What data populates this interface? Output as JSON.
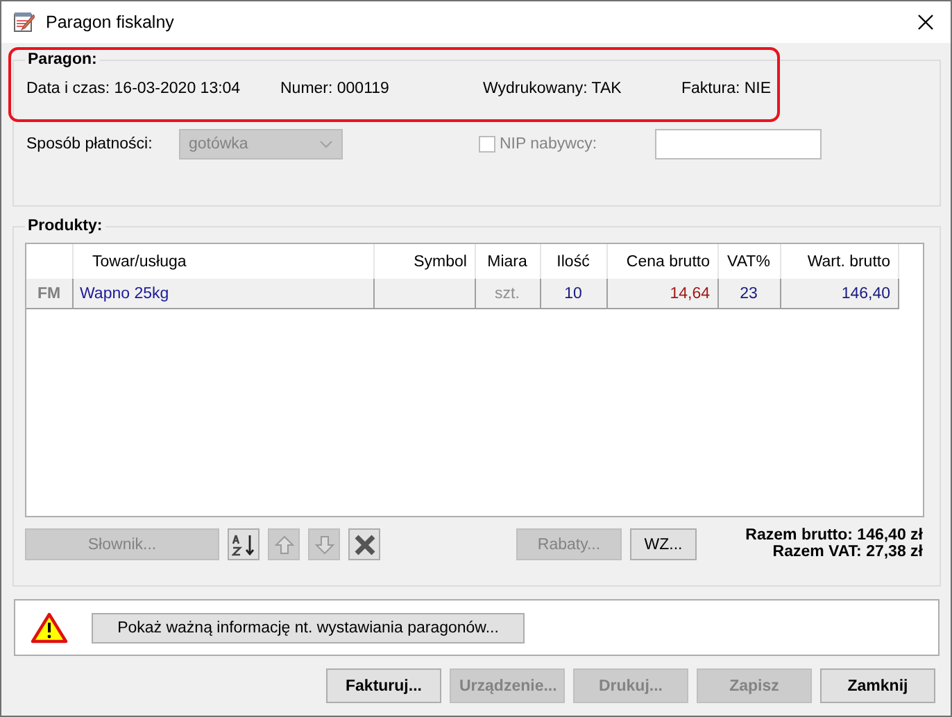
{
  "window": {
    "title": "Paragon fiskalny"
  },
  "paragon": {
    "heading": "Paragon:",
    "highlighted": true,
    "fields": [
      "Data i czas: 16-03-2020 13:04",
      "Numer: 000119",
      "Wydrukowany: TAK",
      "Faktura: NIE"
    ]
  },
  "payment": {
    "label": "Sposób płatności:",
    "value": "gotówka",
    "disabled": true
  },
  "nip": {
    "label": "NIP nabywcy:",
    "checked": false,
    "disabled": true
  },
  "products": {
    "heading": "Produkty:",
    "columns": [
      "Towar/usługa",
      "Symbol",
      "Miara",
      "Ilość",
      "Cena brutto",
      "VAT%",
      "Wart. brutto"
    ],
    "rows": [
      {
        "marker": "FM",
        "cells": [
          "Wapno 25kg",
          "",
          "szt.",
          "10",
          "14,64",
          "23",
          "146,40"
        ]
      }
    ]
  },
  "toolbar": [
    {
      "kind": "text",
      "label": "Słownik...",
      "disabled": true
    },
    {
      "kind": "sort",
      "disabled": false
    },
    {
      "kind": "up",
      "disabled": true
    },
    {
      "kind": "down",
      "disabled": true
    },
    {
      "kind": "delete",
      "disabled": false
    },
    {
      "kind": "text",
      "label": "Rabaty...",
      "disabled": true
    },
    {
      "kind": "text",
      "label": "WZ...",
      "disabled": false
    }
  ],
  "totals": [
    "Razem brutto: 146,40 zł",
    "Razem VAT: 27,38 zł"
  ],
  "warning": {
    "button": "Pokaż ważną informację nt. wystawiania paragonów..."
  },
  "footer_buttons": [
    {
      "label": "Fakturuj...",
      "disabled": false
    },
    {
      "label": "Urządzenie...",
      "disabled": true
    },
    {
      "label": "Drukuj...",
      "disabled": true
    },
    {
      "label": "Zapisz",
      "disabled": true
    },
    {
      "label": "Zamknij",
      "disabled": false
    }
  ]
}
